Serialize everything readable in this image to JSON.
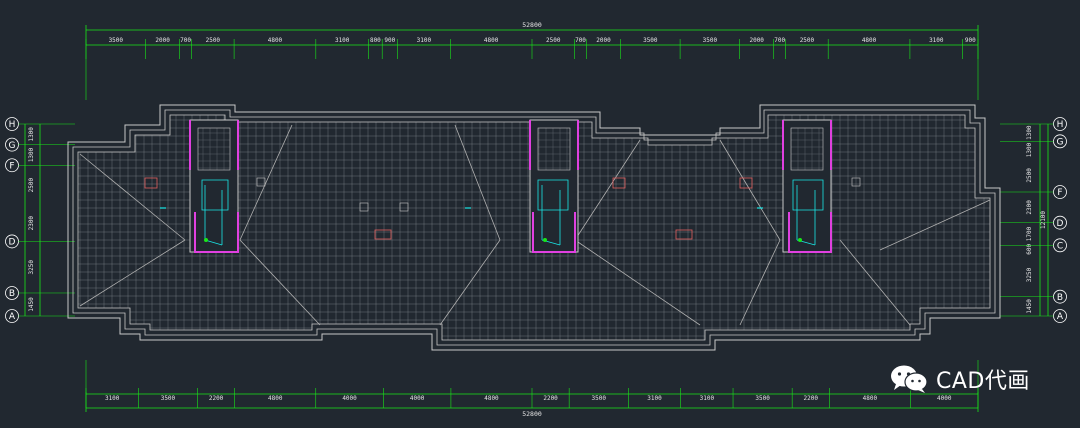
{
  "drawing": {
    "total_length_top": "52800",
    "total_length_bottom": "52800",
    "top_dims": [
      "3500",
      "2000",
      "700",
      "2500",
      "4800",
      "3100",
      "800",
      "900",
      "3100",
      "4800",
      "2500",
      "700",
      "2000",
      "3500",
      "3500",
      "2000",
      "700",
      "2500",
      "4800",
      "3100",
      "900"
    ],
    "bottom_dims": [
      "3100",
      "3500",
      "2200",
      "4800",
      "4000",
      "4000",
      "4800",
      "2200",
      "3500",
      "3100",
      "3100",
      "3500",
      "2200",
      "4800",
      "4000"
    ],
    "left_axis_labels": [
      "H",
      "G",
      "F",
      "D",
      "B",
      "A"
    ],
    "left_dims": [
      "1300",
      "1300",
      "2500",
      "2300",
      "3250",
      "1450"
    ],
    "right_axis_labels": [
      "H",
      "G",
      "F",
      "D",
      "C",
      "B",
      "A"
    ],
    "right_dims": [
      "1300",
      "1300",
      "2500",
      "2300",
      "1700",
      "600",
      "3250",
      "1450"
    ],
    "overall_side_dim": "12100"
  },
  "watermark": {
    "text": "CAD代画",
    "icon": "wechat-icon"
  },
  "colors": {
    "background": "#212830",
    "dimension_green": "#19e619",
    "wall_grey": "#c8c8c8",
    "stair_magenta": "#e040e0",
    "pipe_cyan": "#19e6e6",
    "text_white": "#e6e6e6"
  }
}
